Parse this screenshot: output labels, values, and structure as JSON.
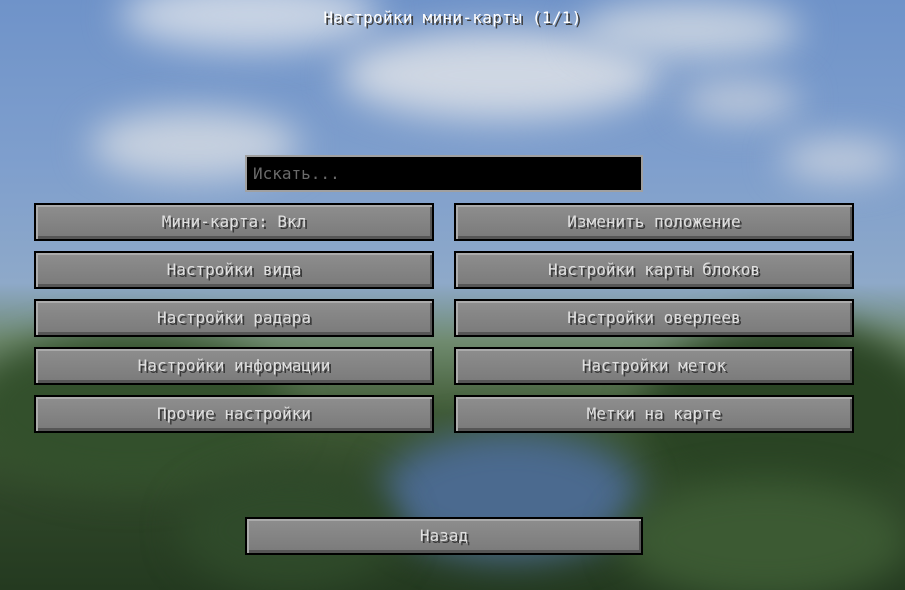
{
  "screen": {
    "title": "Настройки мини-карты (1/1)"
  },
  "search": {
    "placeholder": "Искать..."
  },
  "buttons": {
    "minimap_toggle": "Мини-карта: Вкл",
    "edit_position": "Изменить положение",
    "view_settings": "Настройки вида",
    "block_map_settings": "Настройки карты блоков",
    "radar_settings": "Настройки радара",
    "overlay_settings": "Настройки оверлеев",
    "info_settings": "Настройки информации",
    "waypoint_settings": "Настройки меток",
    "other_settings": "Прочие настройки",
    "map_waypoints": "Метки на карте",
    "back": "Назад"
  }
}
